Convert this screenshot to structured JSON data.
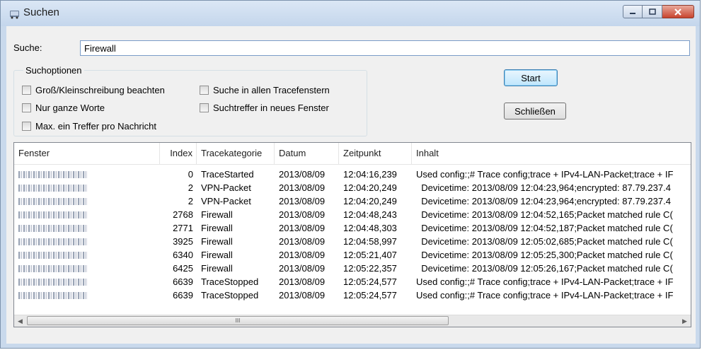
{
  "window": {
    "title": "Suchen"
  },
  "search": {
    "label": "Suche:",
    "value": "Firewall"
  },
  "options": {
    "group_label": "Suchoptionen",
    "case_sensitive": "Groß/Kleinschreibung beachten",
    "whole_words": "Nur ganze Worte",
    "max_one_hit": "Max. ein Treffer pro Nachricht",
    "search_all": "Suche in allen Tracefenstern",
    "new_window": "Suchtreffer in neues Fenster"
  },
  "buttons": {
    "start": "Start",
    "close": "Schließen"
  },
  "table": {
    "headers": [
      "Fenster",
      "Index",
      "Tracekategorie",
      "Datum",
      "Zeitpunkt",
      "Inhalt"
    ],
    "rows": [
      {
        "index": "0",
        "category": "TraceStarted",
        "date": "2013/08/09",
        "time": "12:04:16,239",
        "content": "Used config:;# Trace config;trace + IPv4-LAN-Packet;trace + IF"
      },
      {
        "index": "2",
        "category": "VPN-Packet",
        "date": "2013/08/09",
        "time": "12:04:20,249",
        "content": "  Devicetime: 2013/08/09 12:04:23,964;encrypted: 87.79.237.4"
      },
      {
        "index": "2",
        "category": "VPN-Packet",
        "date": "2013/08/09",
        "time": "12:04:20,249",
        "content": "  Devicetime: 2013/08/09 12:04:23,964;encrypted: 87.79.237.4"
      },
      {
        "index": "2768",
        "category": "Firewall",
        "date": "2013/08/09",
        "time": "12:04:48,243",
        "content": "  Devicetime: 2013/08/09 12:04:52,165;Packet matched rule C("
      },
      {
        "index": "2771",
        "category": "Firewall",
        "date": "2013/08/09",
        "time": "12:04:48,303",
        "content": "  Devicetime: 2013/08/09 12:04:52,187;Packet matched rule C("
      },
      {
        "index": "3925",
        "category": "Firewall",
        "date": "2013/08/09",
        "time": "12:04:58,997",
        "content": "  Devicetime: 2013/08/09 12:05:02,685;Packet matched rule C("
      },
      {
        "index": "6340",
        "category": "Firewall",
        "date": "2013/08/09",
        "time": "12:05:21,407",
        "content": "  Devicetime: 2013/08/09 12:05:25,300;Packet matched rule C("
      },
      {
        "index": "6425",
        "category": "Firewall",
        "date": "2013/08/09",
        "time": "12:05:22,357",
        "content": "  Devicetime: 2013/08/09 12:05:26,167;Packet matched rule C("
      },
      {
        "index": "6639",
        "category": "TraceStopped",
        "date": "2013/08/09",
        "time": "12:05:24,577",
        "content": "Used config:;# Trace config;trace + IPv4-LAN-Packet;trace + IF"
      },
      {
        "index": "6639",
        "category": "TraceStopped",
        "date": "2013/08/09",
        "time": "12:05:24,577",
        "content": "Used config:;# Trace config;trace + IPv4-LAN-Packet;trace + IF"
      }
    ]
  },
  "scrollbar": {
    "thumb_grip": "III"
  }
}
